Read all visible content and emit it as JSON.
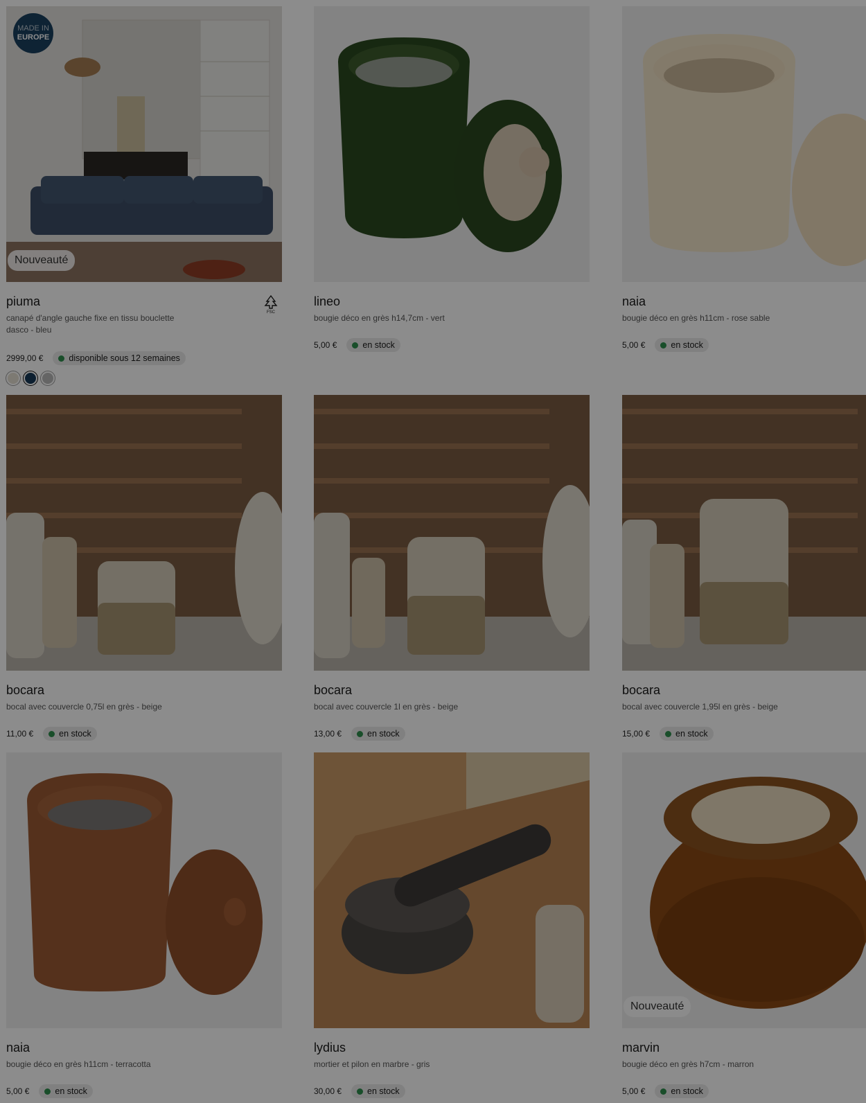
{
  "products": [
    {
      "name": "piuma",
      "description": "canapé d'angle gauche fixe en tissu bouclette dasco - bleu",
      "price": "2999,00 €",
      "stock": "disponible sous 12 semaines",
      "badge": "Nouveauté",
      "made_in_line1": "MADE IN",
      "made_in_line2": "EUROPE",
      "label_icon": "fsc-icon",
      "swatches": [
        "#e4ded2",
        "#173a58",
        "#b9b9b9"
      ]
    },
    {
      "name": "lineo",
      "description": "bougie déco en grès h14,7cm - vert",
      "price": "5,00 €",
      "stock": "en stock"
    },
    {
      "name": "naia",
      "description": "bougie déco en grès h11cm - rose sable",
      "price": "5,00 €",
      "stock": "en stock"
    },
    {
      "name": "bocara",
      "description": "bocal avec couvercle 0,75l en grès - beige",
      "price": "11,00 €",
      "stock": "en stock"
    },
    {
      "name": "bocara",
      "description": "bocal avec couvercle 1l en grès - beige",
      "price": "13,00 €",
      "stock": "en stock"
    },
    {
      "name": "bocara",
      "description": "bocal avec couvercle 1,95l en grès - beige",
      "price": "15,00 €",
      "stock": "en stock"
    },
    {
      "name": "naia",
      "description": "bougie déco en grès h11cm - terracotta",
      "price": "5,00 €",
      "stock": "en stock"
    },
    {
      "name": "lydius",
      "description": "mortier et pilon en marbre - gris",
      "price": "30,00 €",
      "stock": "en stock"
    },
    {
      "name": "marvin",
      "description": "bougie déco en grès h7cm - marron",
      "price": "5,00 €",
      "stock": "en stock",
      "badge": "Nouveauté"
    }
  ]
}
